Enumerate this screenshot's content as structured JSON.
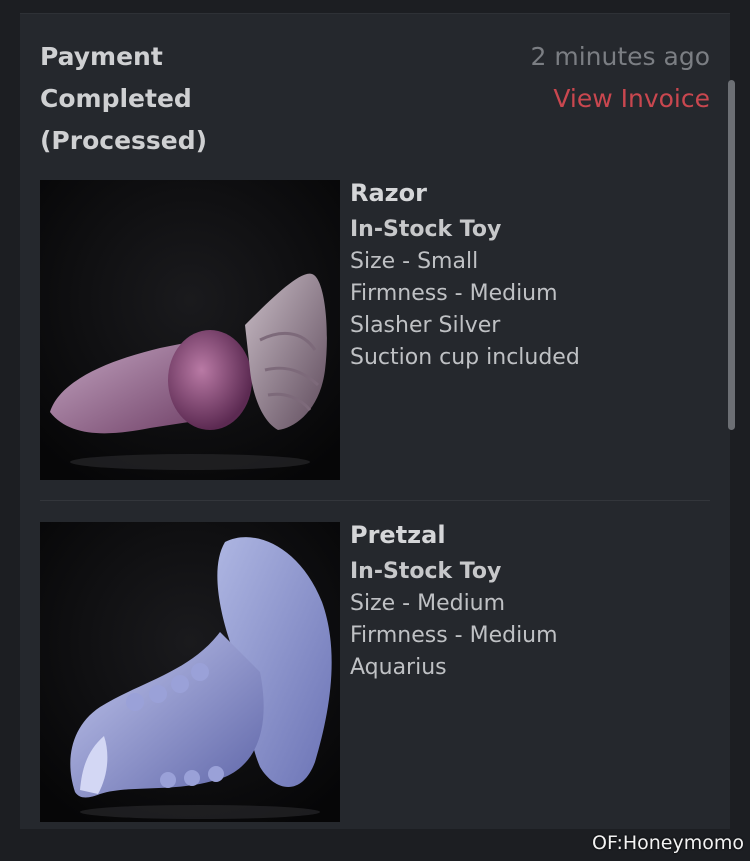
{
  "header": {
    "title_lines": [
      "Payment",
      "Completed",
      "(Processed)"
    ],
    "timestamp": "2 minutes ago",
    "invoice_link": "View Invoice"
  },
  "items": [
    {
      "name": "Razor",
      "type": "In-Stock Toy",
      "options": [
        "Size - Small",
        "Firmness - Medium",
        "Slasher Silver",
        "Suction cup included"
      ],
      "image_colors": [
        "#8e5a84",
        "#b89ab4"
      ]
    },
    {
      "name": "Pretzal",
      "type": "In-Stock Toy",
      "options": [
        "Size - Medium",
        "Firmness - Medium",
        "Aquarius"
      ],
      "image_colors": [
        "#7f86c6",
        "#b5bde6"
      ]
    }
  ],
  "watermark": "OF:Honeymomo",
  "colors": {
    "background": "#1c1e22",
    "card": "#25282d",
    "accent_link": "#c9474f"
  }
}
